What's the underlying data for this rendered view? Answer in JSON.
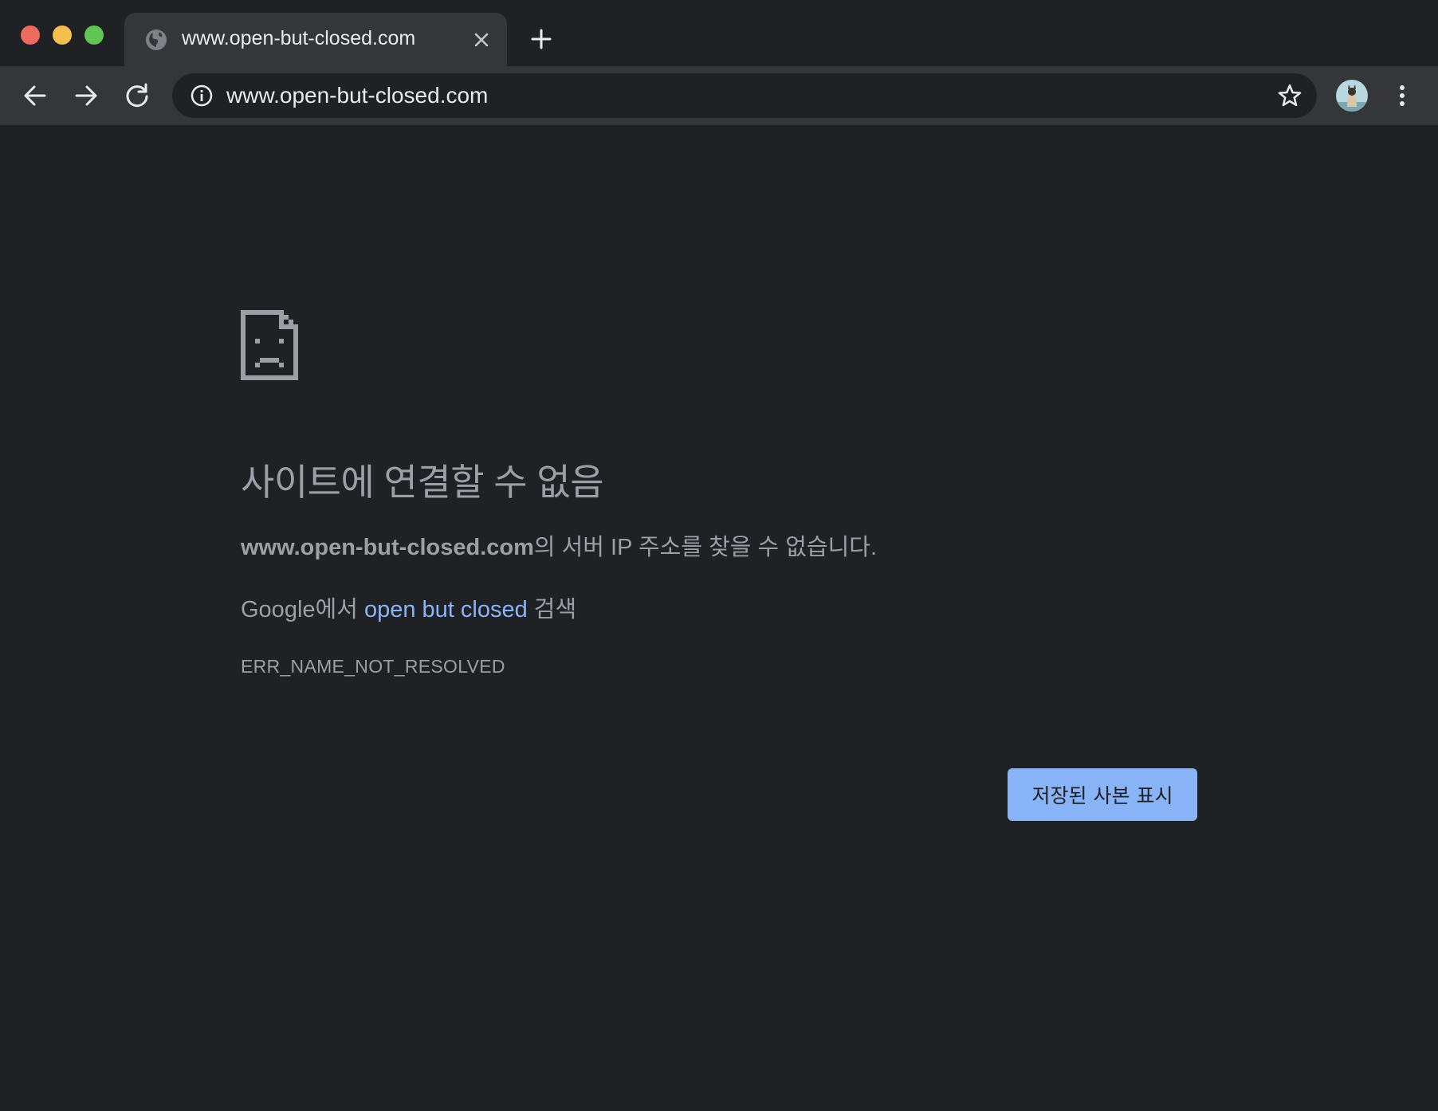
{
  "window": {
    "traffic_lights": {
      "close_color": "#ed6a5e",
      "minimize_color": "#f5bf4f",
      "zoom_color": "#61c554"
    }
  },
  "tab": {
    "title": "www.open-but-closed.com",
    "favicon": "globe-icon",
    "close_icon": "close-icon"
  },
  "new_tab_icon": "plus-icon",
  "toolbar": {
    "back_icon": "arrow-left-icon",
    "forward_icon": "arrow-right-icon",
    "reload_icon": "reload-icon",
    "omnibox": {
      "info_icon": "info-icon",
      "url": "www.open-but-closed.com",
      "bookmark_icon": "star-icon"
    },
    "avatar": "profile-avatar",
    "menu_icon": "kebab-menu-icon"
  },
  "error_page": {
    "icon": "sad-document-icon",
    "title": "사이트에 연결할 수 없음",
    "description_host": "www.open-but-closed.com",
    "description_rest": "의 서버 IP 주소를 찾을 수 없습니다.",
    "search_prefix": "Google에서 ",
    "search_link": "open but closed",
    "search_suffix": " 검색",
    "error_code": "ERR_NAME_NOT_RESOLVED",
    "button_label": "저장된 사본 표시"
  },
  "colors": {
    "background": "#202124",
    "toolbar": "#35363a",
    "text_muted": "#9aa0a6",
    "link": "#8ab4f8",
    "button_bg": "#8ab4f8"
  }
}
